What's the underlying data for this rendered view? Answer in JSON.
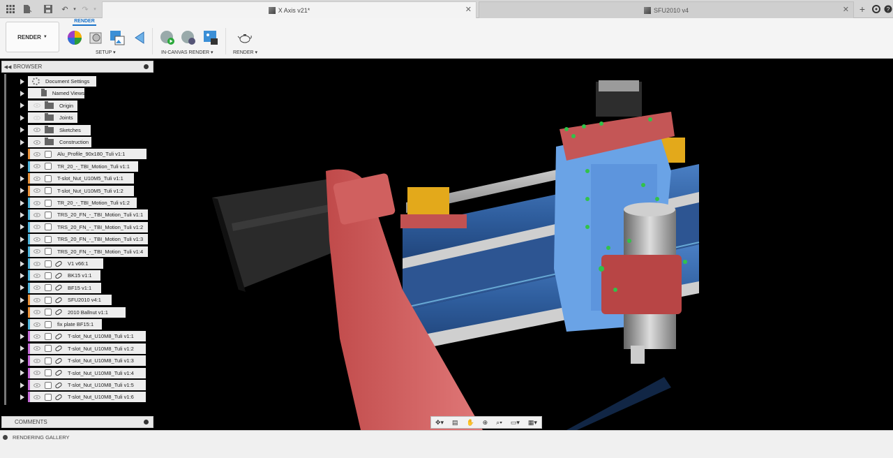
{
  "tabs": {
    "active": {
      "title": "X Axis v21*"
    },
    "inactive": {
      "title": "SFU2010 v4"
    }
  },
  "toolbar": {
    "workspace_label": "RENDER",
    "active_tab": "RENDER",
    "groups": [
      {
        "label": "SETUP"
      },
      {
        "label": "IN-CANVAS RENDER"
      },
      {
        "label": "RENDER"
      }
    ]
  },
  "browser": {
    "title": "BROWSER",
    "items": [
      {
        "label": "Document Settings",
        "kind": "settings",
        "color": ""
      },
      {
        "label": "Named Views",
        "kind": "folder",
        "color": ""
      },
      {
        "label": "Origin",
        "kind": "folder-dim",
        "color": ""
      },
      {
        "label": "Joints",
        "kind": "folder-dim",
        "color": ""
      },
      {
        "label": "Sketches",
        "kind": "folder",
        "color": ""
      },
      {
        "label": "Construction",
        "kind": "folder",
        "color": ""
      },
      {
        "label": "Alu_Profile_90x180_Tuli v1:1",
        "kind": "comp",
        "color": "#e8913a"
      },
      {
        "label": "TR_20_-_TBI_Motion_Tuli v1:1",
        "kind": "comp",
        "color": "#4fb3d9"
      },
      {
        "label": "T-slot_Nut_U10M5_Tuli v1:1",
        "kind": "comp",
        "color": "#e8913a"
      },
      {
        "label": "T-slot_Nut_U10M5_Tuli v1:2",
        "kind": "comp",
        "color": "#e8913a"
      },
      {
        "label": "TR_20_-_TBI_Motion_Tuli v1:2",
        "kind": "comp",
        "color": "#4fb3d9"
      },
      {
        "label": "TRS_20_FN_-_TBI_Motion_Tuli v1:1",
        "kind": "comp",
        "color": "#4fb3d9"
      },
      {
        "label": "TRS_20_FN_-_TBI_Motion_Tuli v1:2",
        "kind": "comp",
        "color": "#4fb3d9"
      },
      {
        "label": "TRS_20_FN_-_TBI_Motion_Tuli v1:3",
        "kind": "comp",
        "color": "#4fb3d9"
      },
      {
        "label": "TRS_20_FN_-_TBI_Motion_Tuli v1:4",
        "kind": "comp",
        "color": "#4fb3d9"
      },
      {
        "label": "V1 v66:1",
        "kind": "link",
        "color": "#4fb3d9"
      },
      {
        "label": "BK15 v1:1",
        "kind": "link",
        "color": "#4fb3d9"
      },
      {
        "label": "BF15 v1:1",
        "kind": "link",
        "color": "#4fb3d9"
      },
      {
        "label": "SFU2010 v4:1",
        "kind": "link",
        "color": "#e8913a"
      },
      {
        "label": "2010 Ballnut v1:1",
        "kind": "link",
        "color": "#e8913a"
      },
      {
        "label": "fix plate BF15:1",
        "kind": "comp",
        "color": "#4fb3d9"
      },
      {
        "label": "T-slot_Nut_U10M8_Tuli v1:1",
        "kind": "link",
        "color": "#c46ad6"
      },
      {
        "label": "T-slot_Nut_U10M8_Tuli v1:2",
        "kind": "link",
        "color": "#c46ad6"
      },
      {
        "label": "T-slot_Nut_U10M8_Tuli v1:3",
        "kind": "link",
        "color": "#c46ad6"
      },
      {
        "label": "T-slot_Nut_U10M8_Tuli v1:4",
        "kind": "link",
        "color": "#c46ad6"
      },
      {
        "label": "T-slot_Nut_U10M8_Tuli v1:5",
        "kind": "link",
        "color": "#c46ad6"
      },
      {
        "label": "T-slot_Nut_U10M8_Tuli v1:6",
        "kind": "link",
        "color": "#c46ad6"
      }
    ]
  },
  "comments": {
    "title": "COMMENTS"
  },
  "gallery": {
    "title": "RENDERING GALLERY"
  }
}
